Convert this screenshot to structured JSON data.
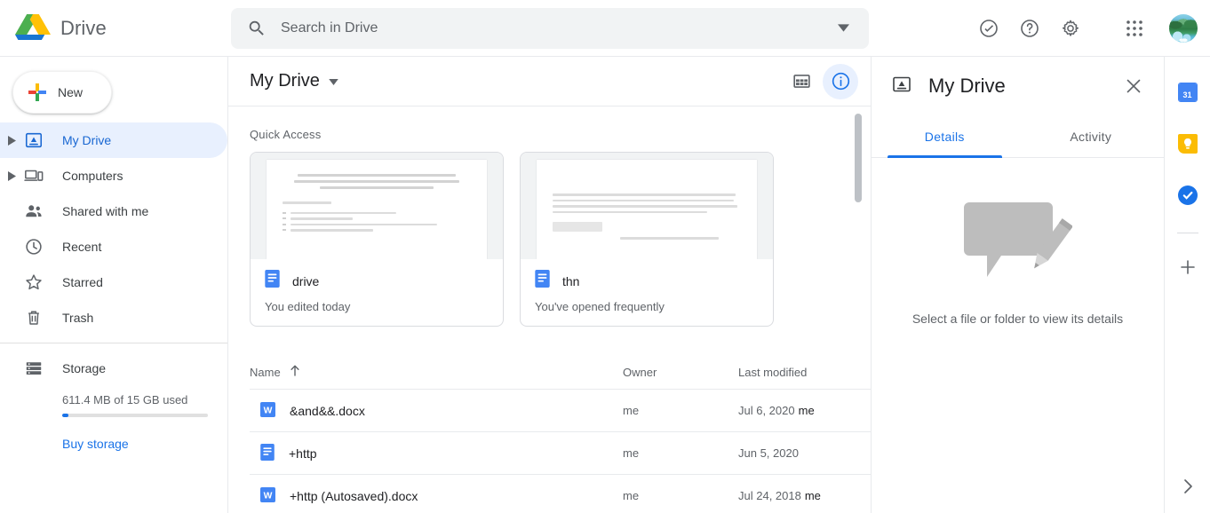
{
  "header": {
    "product_name": "Drive",
    "logo_icon": "drive-logo",
    "search": {
      "placeholder": "Search in Drive",
      "value": "",
      "search_icon": "search-icon",
      "options_icon": "chevron-down-icon"
    },
    "actions": [
      {
        "name": "support-icon",
        "label": "Support"
      },
      {
        "name": "help-icon",
        "label": "Help"
      },
      {
        "name": "gear-icon",
        "label": "Settings"
      },
      {
        "name": "apps-grid-icon",
        "label": "Google apps"
      }
    ],
    "avatar_label": "Account"
  },
  "sidebar": {
    "new_button": {
      "label": "New",
      "icon": "plus-icon"
    },
    "items": [
      {
        "label": "My Drive",
        "icon": "drive-outline-icon",
        "expandable": true,
        "active": true
      },
      {
        "label": "Computers",
        "icon": "computer-icon",
        "expandable": true,
        "active": false
      },
      {
        "label": "Shared with me",
        "icon": "people-icon",
        "expandable": false,
        "active": false
      },
      {
        "label": "Recent",
        "icon": "clock-icon",
        "expandable": false,
        "active": false
      },
      {
        "label": "Starred",
        "icon": "star-icon",
        "expandable": false,
        "active": false
      },
      {
        "label": "Trash",
        "icon": "trash-icon",
        "expandable": false,
        "active": false
      }
    ],
    "storage": {
      "label": "Storage",
      "icon": "storage-icon",
      "usage_text": "611.4 MB of 15 GB used",
      "used_percent": 4,
      "buy_link": "Buy storage",
      "accent_color": "#1a73e8"
    }
  },
  "content_toolbar": {
    "breadcrumb": "My Drive",
    "breadcrumb_caret": "chevron-down-icon",
    "grid_view_icon": "grid-view-icon",
    "details_icon": "info-icon",
    "details_active": true
  },
  "quick_access": {
    "section_label": "Quick Access",
    "cards": [
      {
        "name": "drive",
        "subtitle": "You edited today",
        "file_icon": "google-docs-icon",
        "preview_kind": "document"
      },
      {
        "name": "thn",
        "subtitle": "You've opened frequently",
        "file_icon": "google-docs-icon",
        "preview_kind": "document"
      }
    ]
  },
  "file_list": {
    "columns": [
      {
        "label": "Name",
        "sort_icon": "arrow-up-icon"
      },
      {
        "label": "Owner"
      },
      {
        "label": "Last modified"
      }
    ],
    "rows": [
      {
        "name": "&and&&.docx",
        "icon": "word-doc-icon",
        "owner": "me",
        "modified": "Jul 6, 2020",
        "modified_by": "me"
      },
      {
        "name": "+http",
        "icon": "google-docs-icon",
        "owner": "me",
        "modified": "Jun 5, 2020",
        "modified_by": ""
      },
      {
        "name": "+http (Autosaved).docx",
        "icon": "word-doc-icon",
        "owner": "me",
        "modified": "Jul 24, 2018",
        "modified_by": "me"
      }
    ]
  },
  "details_panel": {
    "icon": "drive-outline-icon",
    "title": "My Drive",
    "close_icon": "close-icon",
    "tabs": [
      {
        "label": "Details",
        "active": true
      },
      {
        "label": "Activity",
        "active": false
      }
    ],
    "empty_illustration": "comment-pencil-illustration",
    "empty_text": "Select a file or folder to view its details",
    "accent_color": "#1a73e8"
  },
  "right_rail": {
    "apps": [
      {
        "name": "google-calendar-icon",
        "label": "Calendar",
        "badge": "31"
      },
      {
        "name": "google-keep-icon",
        "label": "Keep"
      },
      {
        "name": "google-tasks-icon",
        "label": "Tasks"
      }
    ],
    "add_button": {
      "name": "add-app-icon",
      "label": "+"
    },
    "expand_button": {
      "name": "chevron-right-icon",
      "label": "Show side panel"
    }
  }
}
